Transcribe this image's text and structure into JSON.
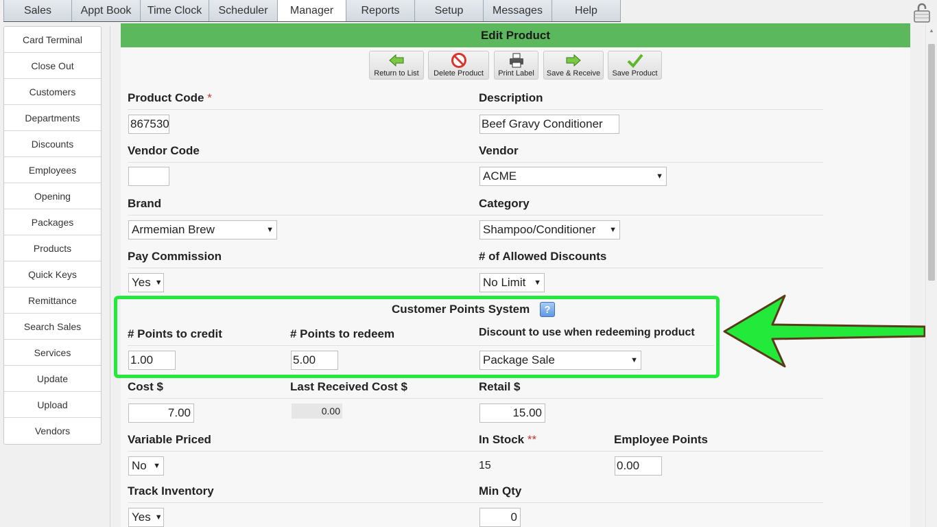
{
  "topnav": [
    "Sales",
    "Appt Book",
    "Time Clock",
    "Scheduler",
    "Manager",
    "Reports",
    "Setup",
    "Messages",
    "Help"
  ],
  "sidebar": [
    "Card Terminal",
    "Close Out",
    "Customers",
    "Departments",
    "Discounts",
    "Employees",
    "Opening",
    "Packages",
    "Products",
    "Quick Keys",
    "Remittance",
    "Search Sales",
    "Services",
    "Update",
    "Upload",
    "Vendors"
  ],
  "page": {
    "title": "Edit Product"
  },
  "toolbar": {
    "return": "Return to List",
    "delete": "Delete Product",
    "print": "Print Label",
    "save_receive": "Save & Receive",
    "save": "Save Product"
  },
  "form": {
    "product_code": {
      "label": "Product Code",
      "required": "*",
      "value": "867530"
    },
    "description": {
      "label": "Description",
      "value": "Beef Gravy Conditioner"
    },
    "vendor_code": {
      "label": "Vendor Code",
      "value": ""
    },
    "vendor": {
      "label": "Vendor",
      "value": "ACME"
    },
    "brand": {
      "label": "Brand",
      "value": "Armemian Brew"
    },
    "category": {
      "label": "Category",
      "value": "Shampoo/Conditioner"
    },
    "pay_commission": {
      "label": "Pay Commission",
      "value": "Yes"
    },
    "allowed_discounts": {
      "label": "# of Allowed Discounts",
      "value": "No Limit"
    },
    "points": {
      "title": "Customer Points System",
      "help": "?",
      "credit_label": "# Points to credit",
      "credit_value": "1.00",
      "redeem_label": "# Points to redeem",
      "redeem_value": "5.00",
      "discount_label": "Discount to use when redeeming product",
      "discount_value": "Package Sale"
    },
    "cost": {
      "label": "Cost $",
      "value": "7.00"
    },
    "last_cost": {
      "label": "Last Received Cost $",
      "value": "0.00"
    },
    "retail": {
      "label": "Retail $",
      "value": "15.00"
    },
    "variable_priced": {
      "label": "Variable Priced",
      "value": "No"
    },
    "in_stock": {
      "label": "In Stock",
      "required": "**",
      "value": "15"
    },
    "employee_points": {
      "label": "Employee Points",
      "value": "0.00"
    },
    "track_inventory": {
      "label": "Track Inventory",
      "value": "Yes"
    },
    "min_qty": {
      "label": "Min Qty",
      "value": "0"
    }
  },
  "colors": {
    "header": "#5cb85c",
    "highlight": "#23ea3a"
  }
}
